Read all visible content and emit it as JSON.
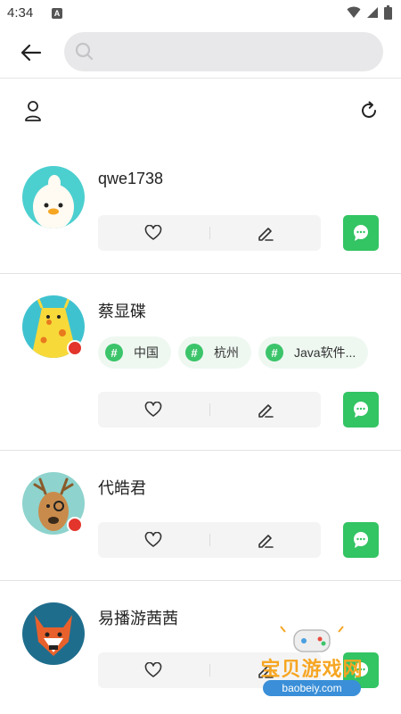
{
  "status_bar": {
    "time": "4:34",
    "notif_letter": "A"
  },
  "search": {
    "placeholder": ""
  },
  "users": [
    {
      "name": "qwe1738",
      "tags": []
    },
    {
      "name": "蔡显碟",
      "tags": [
        "中国",
        "杭州",
        "Java软件..."
      ]
    },
    {
      "name": "代皓君",
      "tags": []
    },
    {
      "name": "易播游茜茜",
      "tags": []
    }
  ],
  "watermark": {
    "title": "宝贝游戏网",
    "url": "baobeiy.com"
  },
  "colors": {
    "accent": "#33c463",
    "tag_bg": "#eef8f1",
    "action_bg": "#f4f4f5",
    "badge": "#e3352b"
  },
  "icons": {
    "back": "arrow-left-icon",
    "search": "search-icon",
    "user": "user-icon",
    "refresh": "refresh-icon",
    "like": "heart-icon",
    "edit": "pencil-icon",
    "chat": "chat-bubble-icon"
  }
}
